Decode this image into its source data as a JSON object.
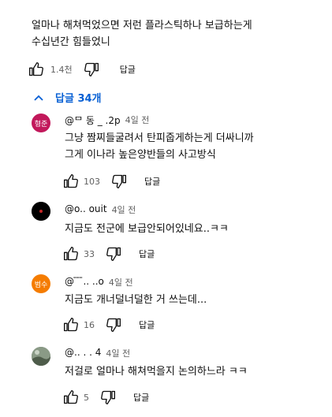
{
  "main_comment": {
    "text": "얼마나 해쳐먹었으면 저런 플라스틱하나 보급하는게\n수십년간 힘들었니",
    "like_count": "1.4천",
    "reply_label": "답글"
  },
  "replies_toggle": {
    "chevron": "^",
    "label": "답글 34개"
  },
  "replies": [
    {
      "avatar_text": "형준",
      "avatar_color": "#c2185b",
      "handle": "@ᄆ 동 _ .2p",
      "time": "4일 전",
      "text": "그냥 짬찌들굴려서 탄피줍게하는게 더싸니까\n그게 이나라 높은양반들의 사고방식",
      "like_count": "103",
      "reply_label": "답글"
    },
    {
      "avatar_text": "",
      "avatar_color": "#000000",
      "handle": "@o..  ouit",
      "time": "4일 전",
      "text": "지금도 전군에 보급안되어있네요..ㅋㅋ",
      "like_count": "33",
      "reply_label": "답글"
    },
    {
      "avatar_text": "범수",
      "avatar_color": "#f57c00",
      "handle": "@ ̄ ̄ ̄.. ..o",
      "time": "4일 전",
      "text": "지금도 개너덜너덜한 거 쓰는데...",
      "like_count": "16",
      "reply_label": "답글"
    },
    {
      "avatar_text": "",
      "avatar_color": "#6b7a6a",
      "handle": "@..  .  . 4",
      "time": "4일 전",
      "text": "저걸로 얼마나 해쳐먹을지 논의하느라 ㅋㅋ",
      "like_count": "5",
      "reply_label": "답글"
    }
  ]
}
